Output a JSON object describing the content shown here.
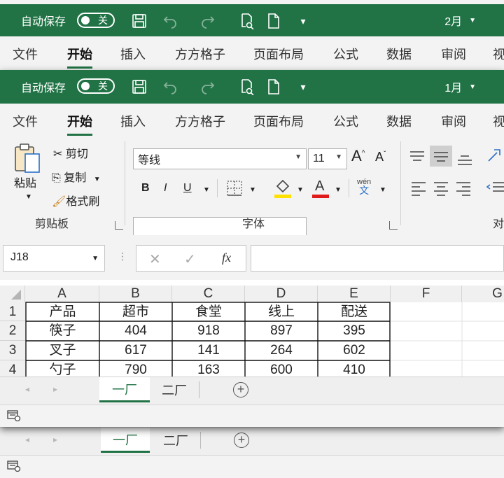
{
  "back_window": {
    "title_bar": {
      "autosave_label": "自动保存",
      "toggle_state": "关",
      "filename": "2月"
    },
    "tabs": [
      "文件",
      "开始",
      "插入",
      "方方格子",
      "页面布局",
      "公式",
      "数据",
      "审阅",
      "视"
    ],
    "active_tab": "开始",
    "sheets": [
      "一厂",
      "二厂"
    ],
    "active_sheet": "一厂"
  },
  "front_window": {
    "title_bar": {
      "autosave_label": "自动保存",
      "toggle_state": "关",
      "filename": "1月"
    },
    "tabs": [
      "文件",
      "开始",
      "插入",
      "方方格子",
      "页面布局",
      "公式",
      "数据",
      "审阅",
      "视"
    ],
    "active_tab": "开始",
    "ribbon": {
      "clipboard": {
        "paste": "粘贴",
        "cut": "剪切",
        "copy": "复制",
        "format_painter": "格式刷",
        "group_label": "剪贴板"
      },
      "font": {
        "font_name": "等线",
        "font_size": "11",
        "bold": "B",
        "italic": "I",
        "underline": "U",
        "group_label": "字体",
        "grow_font": "A",
        "shrink_font": "A",
        "phonetic_top": "wén",
        "phonetic_bottom": "文"
      },
      "alignment": {
        "group_label": "对"
      }
    },
    "formula_bar": {
      "name_box": "J18",
      "cancel": "✕",
      "enter": "✓",
      "fx": "fx",
      "formula": ""
    },
    "grid": {
      "columns": [
        "A",
        "B",
        "C",
        "D",
        "E",
        "F",
        "G"
      ],
      "rows": [
        {
          "num": "1",
          "cells": [
            "产品",
            "超市",
            "食堂",
            "线上",
            "配送"
          ]
        },
        {
          "num": "2",
          "cells": [
            "筷子",
            "404",
            "918",
            "897",
            "395"
          ]
        },
        {
          "num": "3",
          "cells": [
            "叉子",
            "617",
            "141",
            "264",
            "602"
          ]
        },
        {
          "num": "4",
          "cells": [
            "勺子",
            "790",
            "163",
            "600",
            "410"
          ]
        }
      ]
    },
    "sheets": [
      "一厂",
      "二厂"
    ],
    "active_sheet": "一厂"
  },
  "colors": {
    "excel_green": "#217346",
    "highlight_yellow": "#ffe100",
    "font_red": "#e01b1b"
  }
}
